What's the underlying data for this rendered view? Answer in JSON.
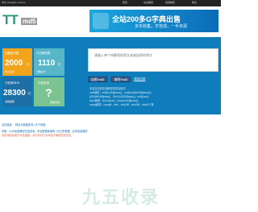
{
  "topbar": {
    "left": "中文 | English | Forum",
    "links": [
      "首页",
      "在线解密",
      "批量解密",
      "联系"
    ]
  },
  "logo": {
    "text": "TT",
    "sub": "md5"
  },
  "banner": {
    "title": "全站200多G字典出售",
    "subtitle": "多年收集，辛苦成，一手资源"
  },
  "tiles": [
    {
      "caption": "已解密次数",
      "value": "2000",
      "unit": "亿",
      "sub": "共计总计"
    },
    {
      "caption": "今日解密数",
      "value": "1110",
      "unit": "亿",
      "sub": "次数总计"
    },
    {
      "caption": "已收录MD5",
      "value": "28300",
      "unit": "亿",
      "sub": "总数据量"
    },
    {
      "caption": "付费查询",
      "value": "?",
      "unit": "",
      "sub": "查看详情"
    }
  ],
  "input": {
    "placeholder": "请输入单个待解密的密文或者加密的明文"
  },
  "buttons": {
    "encrypt": "加密/md5",
    "decrypt": "解密/md5",
    "clear": "清除结果"
  },
  "result_lines": [
    "本站支持的在线解密类型及格式:",
    "md5解密 , md5(md5($pass)) , md5(md5(md5($pass)))",
    "MD5(MD5($pass)) , SHA1(MD5($pass)) , md5(unix)",
    "sha1解密 , sha1(sha1) , sha1(md5($pass))",
    "mysql解密 , mysql5 , ntlm , sha256 , sha384 , sha512 等"
  ],
  "footer": {
    "line1": "友情链接：  网站大数据查询 | 天下网盘",
    "line2": "说明：md5加密解密在线查询 , 本站数据库拥有 1万亿条数据 , 支持批量解密",
    "line3": "请勿将本站用于非法用途，对于非法行为本站不承担任何责任。"
  },
  "watermark": "九五收录",
  "colors": {
    "band": "#0f7dbb",
    "tile1": "#f2a51c",
    "tile2": "#57b7c8",
    "tile3": "#1e6fa6",
    "tile4": "#7cc392",
    "banner": "#0b6bb8",
    "watermark": "#d6ece3"
  }
}
